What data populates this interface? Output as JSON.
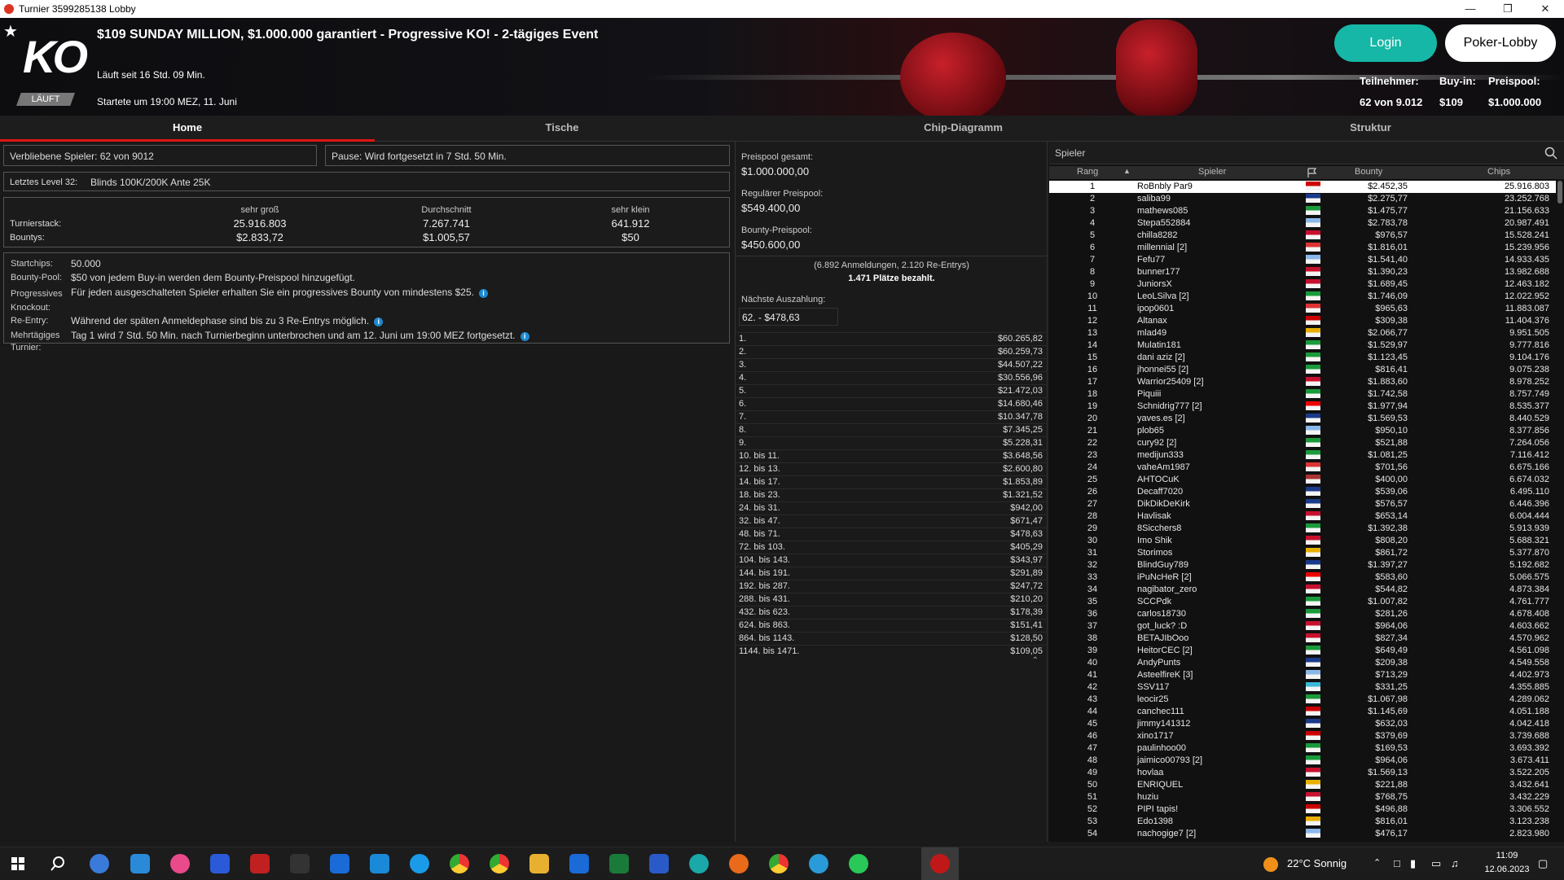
{
  "window": {
    "title": "Turnier 3599285138 Lobby"
  },
  "header": {
    "logo": "KO",
    "status_badge": "LÄUFT",
    "tournament_name": "$109 SUNDAY MILLION, $1.000.000 garantiert - Progressive KO! - 2-tägiges Event",
    "running": "Läuft seit 16 Std. 09 Min.",
    "started": "Startete um 19:00 MEZ, 11. Juni",
    "login_label": "Login",
    "lobby_label": "Poker-Lobby",
    "stats": {
      "players_label": "Teilnehmer:",
      "players_value": "62 von 9.012",
      "buyin_label": "Buy-in:",
      "buyin_value": "$109",
      "prizepool_label": "Preispool:",
      "prizepool_value": "$1.000.000"
    }
  },
  "tabs": [
    "Home",
    "Tische",
    "Chip-Diagramm",
    "Struktur"
  ],
  "home": {
    "remaining": "Verbliebene Spieler: 62 von 9012",
    "pause": "Pause: Wird fortgesetzt in 7 Std. 50 Min.",
    "level_label": "Letztes Level 32:",
    "level_value": "Blinds 100K/200K Ante 25K",
    "stack_headers": [
      "sehr groß",
      "Durchschnitt",
      "sehr klein"
    ],
    "stack_label": "Turnierstack:",
    "stack_values": [
      "25.916.803",
      "7.267.741",
      "641.912"
    ],
    "bounty_label": "Bountys:",
    "bounty_values": [
      "$2.833,72",
      "$1.005,57",
      "$50"
    ],
    "info": {
      "startchips_label": "Startchips:",
      "startchips": "50.000",
      "bountypool_label": "Bounty-Pool:",
      "bountypool": "$50 von jedem Buy-in werden dem Bounty-Preispool hinzugefügt.",
      "progressive_label": "Progressives Knockout:",
      "progressive": "Für jeden ausgeschalteten Spieler erhalten Sie ein progressives Bounty von mindestens $25.",
      "reentry_label": "Re-Entry:",
      "reentry": "Während der späten Anmeldephase sind bis zu 3 Re-Entrys möglich.",
      "multiday_label": "Mehrtägiges Turnier:",
      "multiday": "Tag 1 wird 7 Std. 50 Min. nach Turnierbeginn unterbrochen und am 12. Juni um 19:00 MEZ fortgesetzt."
    }
  },
  "prizepool": {
    "total_label": "Preispool gesamt:",
    "total": "$1.000.000,00",
    "regular_label": "Regulärer Preispool:",
    "regular": "$549.400,00",
    "bounty_label": "Bounty-Preispool:",
    "bounty": "$450.600,00",
    "registrations": "(6.892 Anmeldungen, 2.120 Re-Entrys)",
    "paid": "1.471 Plätze bezahlt.",
    "next_label": "Nächste Auszahlung:",
    "next_value": "62. - $478,63",
    "payouts": [
      [
        "1.",
        "$60.265,82"
      ],
      [
        "2.",
        "$60.259,73"
      ],
      [
        "3.",
        "$44.507,22"
      ],
      [
        "4.",
        "$30.556,96"
      ],
      [
        "5.",
        "$21.472,03"
      ],
      [
        "6.",
        "$14.680,46"
      ],
      [
        "7.",
        "$10.347,78"
      ],
      [
        "8.",
        "$7.345,25"
      ],
      [
        "9.",
        "$5.228,31"
      ],
      [
        "10. bis 11.",
        "$3.648,56"
      ],
      [
        "12. bis 13.",
        "$2.600,80"
      ],
      [
        "14. bis 17.",
        "$1.853,89"
      ],
      [
        "18. bis 23.",
        "$1.321,52"
      ],
      [
        "24. bis 31.",
        "$942,00"
      ],
      [
        "32. bis 47.",
        "$671,47"
      ],
      [
        "48. bis 71.",
        "$478,63"
      ],
      [
        "72. bis 103.",
        "$405,29"
      ],
      [
        "104. bis 143.",
        "$343,97"
      ],
      [
        "144. bis 191.",
        "$291,89"
      ],
      [
        "192. bis 287.",
        "$247,72"
      ],
      [
        "288. bis 431.",
        "$210,20"
      ],
      [
        "432. bis 623.",
        "$178,39"
      ],
      [
        "624. bis 863.",
        "$151,41"
      ],
      [
        "864. bis 1143.",
        "$128,50"
      ],
      [
        "1144. bis 1471.",
        "$109,05"
      ]
    ]
  },
  "players": {
    "search_placeholder": "Spieler",
    "columns": [
      "Rang",
      "Spieler",
      "Bounty",
      "Chips"
    ],
    "rows": [
      [
        1,
        "RoBnbly Par9",
        "$2.452,35",
        "25.916.803",
        "#c00"
      ],
      [
        2,
        "saliba99",
        "$2.275,77",
        "23.252.768",
        "#1a3a8a"
      ],
      [
        3,
        "mathews085",
        "$1.475,77",
        "21.156.633",
        "#1a9a3a"
      ],
      [
        4,
        "Stepa552884",
        "$2.783,78",
        "20.987.491",
        "#8ab8e8"
      ],
      [
        5,
        "chilla8282",
        "$976,57",
        "15.528.241",
        "#c8102e"
      ],
      [
        6,
        "millennial [2]",
        "$1.816,01",
        "15.239.956",
        "#d33"
      ],
      [
        7,
        "Fefu77",
        "$1.541,40",
        "14.933.435",
        "#8ab8e8"
      ],
      [
        8,
        "bunner177",
        "$1.390,23",
        "13.982.688",
        "#c8102e"
      ],
      [
        9,
        "JuniorsX",
        "$1.689,45",
        "12.463.182",
        "#c8102e"
      ],
      [
        10,
        "LeoLSilva [2]",
        "$1.746,09",
        "12.022.952",
        "#1a9a3a"
      ],
      [
        11,
        "ipop0601",
        "$965,63",
        "11.883.087",
        "#d33"
      ],
      [
        12,
        "Altanax",
        "$309,38",
        "11.404.376",
        "#c00"
      ],
      [
        13,
        "mlad49",
        "$2.066,77",
        "9.951.505",
        "#e8b000"
      ],
      [
        14,
        "Mulatin181",
        "$1.529,97",
        "9.777.816",
        "#1a9a3a"
      ],
      [
        15,
        "dani aziz [2]",
        "$1.123,45",
        "9.104.176",
        "#1a9a3a"
      ],
      [
        16,
        "jhonnei55 [2]",
        "$816,41",
        "9.075.238",
        "#1a9a3a"
      ],
      [
        17,
        "Warrior25409 [2]",
        "$1.883,60",
        "8.978.252",
        "#c8102e"
      ],
      [
        18,
        "Piquiii",
        "$1.742,58",
        "8.757.749",
        "#1a9a3a"
      ],
      [
        19,
        "Schnidrig777 [2]",
        "$1.977,94",
        "8.535.377",
        "#e00"
      ],
      [
        20,
        "yaves.es [2]",
        "$1.569,53",
        "8.440.529",
        "#1a3a8a"
      ],
      [
        21,
        "plob65",
        "$950,10",
        "8.377.856",
        "#8ab8e8"
      ],
      [
        22,
        "cury92 [2]",
        "$521,88",
        "7.264.056",
        "#1a9a3a"
      ],
      [
        23,
        "medijun333",
        "$1.081,25",
        "7.116.412",
        "#1a9a3a"
      ],
      [
        24,
        "vaheAm1987",
        "$701,56",
        "6.675.166",
        "#d33"
      ],
      [
        25,
        "AHTOCuK",
        "$400,00",
        "6.674.032",
        "#a33"
      ],
      [
        26,
        "Decaff7020",
        "$539,06",
        "6.495.110",
        "#1a3a8a"
      ],
      [
        27,
        "DikDikDeKirk",
        "$576,57",
        "6.446.396",
        "#1a3a8a"
      ],
      [
        28,
        "Havlisak",
        "$653,14",
        "6.004.444",
        "#c8102e"
      ],
      [
        29,
        "8Sicchers8",
        "$1.392,38",
        "5.913.939",
        "#1a9a3a"
      ],
      [
        30,
        "Imo Shik",
        "$808,20",
        "5.688.321",
        "#c8102e"
      ],
      [
        31,
        "Storimos",
        "$861,72",
        "5.377.870",
        "#e8b000"
      ],
      [
        32,
        "BlindGuy789",
        "$1.397,27",
        "5.192.682",
        "#1a3a8a"
      ],
      [
        33,
        "iPuNcHeR [2]",
        "$583,60",
        "5.066.575",
        "#e00"
      ],
      [
        34,
        "nagibator_zero",
        "$544,82",
        "4.873.384",
        "#c8102e"
      ],
      [
        35,
        "SCCPdk",
        "$1.007,82",
        "4.761.777",
        "#1a9a3a"
      ],
      [
        36,
        "carlos18730",
        "$281,26",
        "4.678.408",
        "#1a9a3a"
      ],
      [
        37,
        "got_luck? :D",
        "$964,06",
        "4.603.662",
        "#c8102e"
      ],
      [
        38,
        "BETAJIbOoo",
        "$827,34",
        "4.570.962",
        "#c8102e"
      ],
      [
        39,
        "HeitorCEC [2]",
        "$649,49",
        "4.561.098",
        "#1a9a3a"
      ],
      [
        40,
        "AndyPunts",
        "$209,38",
        "4.549.558",
        "#1a3a8a"
      ],
      [
        41,
        "AsteelfireK [3]",
        "$713,29",
        "4.402.973",
        "#8ab8e8"
      ],
      [
        42,
        "SSV117",
        "$331,25",
        "4.355.885",
        "#3ab8d8"
      ],
      [
        43,
        "leocir25",
        "$1.067,98",
        "4.289.062",
        "#1a9a3a"
      ],
      [
        44,
        "canchec111",
        "$1.145,69",
        "4.051.188",
        "#c00"
      ],
      [
        45,
        "jimmy141312",
        "$632,03",
        "4.042.418",
        "#1a3a8a"
      ],
      [
        46,
        "xino1717",
        "$379,69",
        "3.739.688",
        "#c00"
      ],
      [
        47,
        "paulinhoo00",
        "$169,53",
        "3.693.392",
        "#1a9a3a"
      ],
      [
        48,
        "jaimico00793 [2]",
        "$964,06",
        "3.673.411",
        "#1a9a3a"
      ],
      [
        49,
        "hovlaa",
        "$1.569,13",
        "3.522.205",
        "#c8102e"
      ],
      [
        50,
        "ENRIQUEL",
        "$221,88",
        "3.432.641",
        "#e8b000"
      ],
      [
        51,
        "huziu",
        "$768,75",
        "3.432.229",
        "#c8102e"
      ],
      [
        52,
        "PIPI tapis!",
        "$496,88",
        "3.306.552",
        "#c00"
      ],
      [
        53,
        "Edo1398",
        "$816,01",
        "3.123.238",
        "#e8b000"
      ],
      [
        54,
        "nachogige7 [2]",
        "$476,17",
        "2.823.980",
        "#8ab8e8"
      ]
    ]
  },
  "taskbar": {
    "weather": "22°C  Sonnig",
    "time": "11:09",
    "date": "12.06.2023"
  }
}
